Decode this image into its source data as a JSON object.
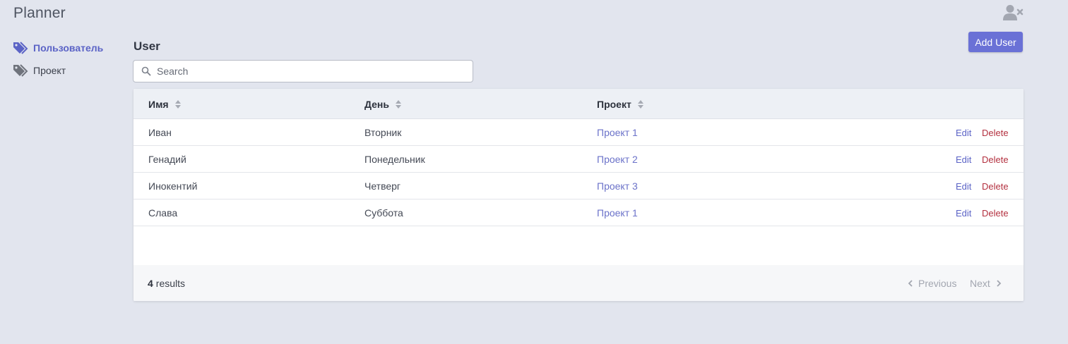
{
  "app": {
    "title": "Planner"
  },
  "sidebar": {
    "items": [
      {
        "label": "Пользователь",
        "icon": "tag-icon",
        "active": true
      },
      {
        "label": "Проект",
        "icon": "tag-icon",
        "active": false
      }
    ]
  },
  "header": {
    "logout_icon": "user-times-icon"
  },
  "main": {
    "title": "User",
    "add_button": "Add User",
    "search": {
      "placeholder": "Search",
      "value": ""
    },
    "table": {
      "columns": [
        "Имя",
        "День",
        "Проект"
      ],
      "rows": [
        {
          "name": "Иван",
          "day": "Вторник",
          "project": "Проект 1",
          "edit": "Edit",
          "delete": "Delete"
        },
        {
          "name": "Генадий",
          "day": "Понедельник",
          "project": "Проект 2",
          "edit": "Edit",
          "delete": "Delete"
        },
        {
          "name": "Инокентий",
          "day": "Четверг",
          "project": "Проект 3",
          "edit": "Edit",
          "delete": "Delete"
        },
        {
          "name": "Слава",
          "day": "Суббота",
          "project": "Проект 1",
          "edit": "Edit",
          "delete": "Delete"
        }
      ]
    },
    "footer": {
      "count": "4",
      "results_label": "results",
      "previous": "Previous",
      "next": "Next"
    }
  },
  "colors": {
    "accent": "#6a71d6",
    "link": "#6b72c9",
    "danger": "#b3303f",
    "background": "#e2e5ee"
  }
}
